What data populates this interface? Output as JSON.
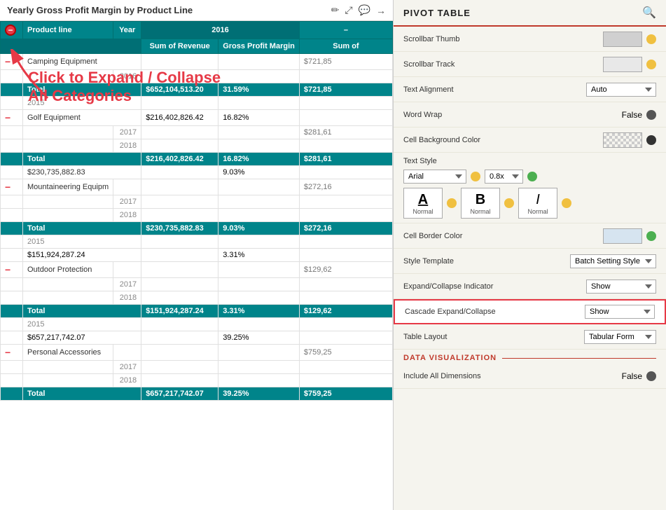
{
  "header": {
    "title": "Yearly Gross Profit Margin by Product Line",
    "icons": [
      "✏",
      "⤢",
      "💬",
      "→"
    ]
  },
  "pivot_panel": {
    "title": "PIVOT TABLE",
    "search_icon": "🔍"
  },
  "table": {
    "col_headers": [
      "Product line",
      "Year",
      "Sum of Revenue",
      "Gross Profit Margin",
      "Sum of"
    ],
    "year_header": "2016",
    "annotation": {
      "text": "Click to Expand / Collapse All Categories"
    }
  },
  "properties": {
    "scrollbar_thumb": {
      "label": "Scrollbar Thumb",
      "color": "gray"
    },
    "scrollbar_track": {
      "label": "Scrollbar Track",
      "color": "light-gray"
    },
    "text_alignment": {
      "label": "Text Alignment",
      "value": "Auto"
    },
    "word_wrap": {
      "label": "Word Wrap",
      "value": "False"
    },
    "cell_bg_color": {
      "label": "Cell Background Color",
      "color": "checkered"
    },
    "text_style": {
      "label": "Text Style"
    },
    "font": {
      "value": "Arial",
      "size": "0.8x"
    },
    "underline_label": "Normal",
    "italic_label": "Normal",
    "cell_border_color": {
      "label": "Cell Border Color",
      "color": "light-blue"
    },
    "style_template": {
      "label": "Style Template",
      "value": "Batch Setting Style"
    },
    "expand_collapse_indicator": {
      "label": "Expand/Collapse Indicator",
      "value": "Show"
    },
    "cascade_expand_collapse": {
      "label": "Cascade Expand/Collapse",
      "value": "Show"
    },
    "table_layout": {
      "label": "Table Layout",
      "value": "Tabular Form"
    }
  },
  "data_visualization": {
    "section_label": "DATA VISUALIZATION",
    "include_all_dimensions": {
      "label": "Include All Dimensions",
      "value": "False"
    }
  },
  "rows": [
    {
      "product": "Camping Equipment",
      "years": [
        {
          "year": "2016",
          "revenue": "",
          "margin": ""
        }
      ],
      "total": {
        "revenue": "$652,104,513.20",
        "margin": "31.59%",
        "sum": "$721,85"
      }
    },
    {
      "product": "Golf Equipment",
      "years": [
        {
          "year": "2015",
          "revenue": "",
          "margin": ""
        },
        {
          "year": "2016",
          "revenue": "$216,402,826.42",
          "margin": "16.82%"
        },
        {
          "year": "2017",
          "revenue": "",
          "margin": ""
        },
        {
          "year": "2018",
          "revenue": "",
          "margin": ""
        }
      ],
      "total": {
        "revenue": "$216,402,826.42",
        "margin": "16.82%",
        "sum": "$281,61"
      }
    },
    {
      "product": "Mountaineering Equipm",
      "years": [
        {
          "year": "2016",
          "revenue": "$230,735,882.83",
          "margin": "9.03%"
        },
        {
          "year": "2017",
          "revenue": "",
          "margin": ""
        },
        {
          "year": "2018",
          "revenue": "",
          "margin": ""
        }
      ],
      "total": {
        "revenue": "$230,735,882.83",
        "margin": "9.03%",
        "sum": "$272,16"
      }
    },
    {
      "product": "Outdoor Protection",
      "years": [
        {
          "year": "2015",
          "revenue": "",
          "margin": ""
        },
        {
          "year": "2016",
          "revenue": "$151,924,287.24",
          "margin": "3.31%"
        },
        {
          "year": "2017",
          "revenue": "",
          "margin": ""
        },
        {
          "year": "2018",
          "revenue": "",
          "margin": ""
        }
      ],
      "total": {
        "revenue": "$151,924,287.24",
        "margin": "3.31%",
        "sum": "$129,62"
      }
    },
    {
      "product": "Personal Accessories",
      "years": [
        {
          "year": "2015",
          "revenue": "",
          "margin": ""
        },
        {
          "year": "2016",
          "revenue": "$657,217,742.07",
          "margin": "39.25%"
        },
        {
          "year": "2017",
          "revenue": "",
          "margin": ""
        },
        {
          "year": "2018",
          "revenue": "",
          "margin": ""
        }
      ],
      "total": {
        "revenue": "$657,217,742.07",
        "margin": "39.25%",
        "sum": "$759,25"
      }
    }
  ],
  "colors": {
    "teal": "#00848a",
    "red": "#e63946",
    "yellow": "#f0c040",
    "green": "#4caf50"
  }
}
